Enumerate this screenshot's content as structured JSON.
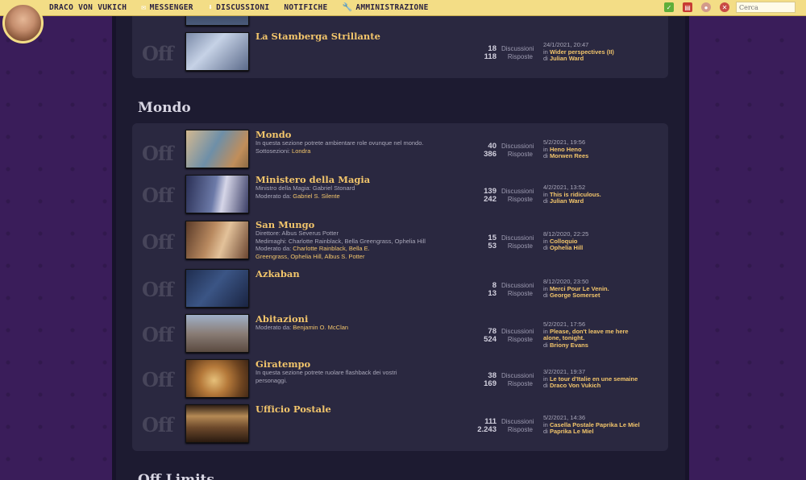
{
  "nav": {
    "brand": "DRACO VON VUKICH",
    "messenger": "MESSENGER",
    "discussioni": "DISCUSSIONI",
    "notifiche": "NOTIFICHE",
    "amministrazione": "AMMINISTRAZIONE",
    "search_placeholder": "Cerca"
  },
  "off_label": "Off",
  "labels": {
    "discussioni": "Discussioni",
    "risposte": "Risposte",
    "in": "in",
    "di": "di"
  },
  "top_forum": {
    "name": "La Stamberga Strillante",
    "discussioni": "18",
    "risposte": "118",
    "last_date": "24/1/2021, 20:47",
    "last_topic": "Wider perspectives (II)",
    "last_user": "Julian Ward"
  },
  "category": "Mondo",
  "next_category": "Off Limits",
  "forums": [
    {
      "name": "Mondo",
      "desc": "In questa sezione potrete ambientare role ovunque nel mondo.",
      "extra_label": "Sottosezioni:",
      "extra_links": "Londra",
      "discussioni": "40",
      "risposte": "386",
      "last_date": "5/2/2021, 19:56",
      "last_topic": "Heno Heno",
      "last_user": "Morwen Rees"
    },
    {
      "name": "Ministero della Magia",
      "desc": "Ministro della Magia: Gabriel Stonard",
      "extra_label": "Moderato da:",
      "extra_links": "Gabriel S. Silente",
      "discussioni": "139",
      "risposte": "242",
      "last_date": "4/2/2021, 13:52",
      "last_topic": "This is ridiculous.",
      "last_user": "Julian Ward"
    },
    {
      "name": "San Mungo",
      "desc": "Direttore: Albus Severus Potter",
      "desc2": "Medimaghi: Charlotte Rainblack, Bella Greengrass, Ophelia Hill",
      "extra_label": "Moderato da:",
      "extra_links": "Charlotte Rainblack, Bella E.",
      "extra_links2": "Greengrass, Ophelia Hill, Albus S. Potter",
      "discussioni": "15",
      "risposte": "53",
      "last_date": "8/12/2020, 22:25",
      "last_topic": "Colloquio",
      "last_user": "Ophelia Hill"
    },
    {
      "name": "Azkaban",
      "discussioni": "8",
      "risposte": "13",
      "last_date": "8/12/2020, 23:50",
      "last_topic": "Merci Pour Le Venin.",
      "last_user": "George Somerset"
    },
    {
      "name": "Abitazioni",
      "extra_label": "Moderato da:",
      "extra_links": "Benjamin O. McClan",
      "discussioni": "78",
      "risposte": "524",
      "last_date": "5/2/2021, 17:56",
      "last_topic": "Please, don't leave me here",
      "last_topic2": "alone, tonight.",
      "last_user": "Briony Evans"
    },
    {
      "name": "Giratempo",
      "desc": "In questa sezione potrete ruolare flashback dei vostri",
      "desc2": "personaggi.",
      "discussioni": "38",
      "risposte": "169",
      "last_date": "3/2/2021, 19:37",
      "last_topic": "Le tour d'Italie en une semaine",
      "last_user": "Draco Von Vukich"
    },
    {
      "name": "Ufficio Postale",
      "discussioni": "111",
      "risposte": "2.243",
      "last_date": "5/2/2021, 14:36",
      "last_topic": "Casella Postale Paprika Le Miel",
      "last_user": "Paprika Le Miel"
    }
  ]
}
